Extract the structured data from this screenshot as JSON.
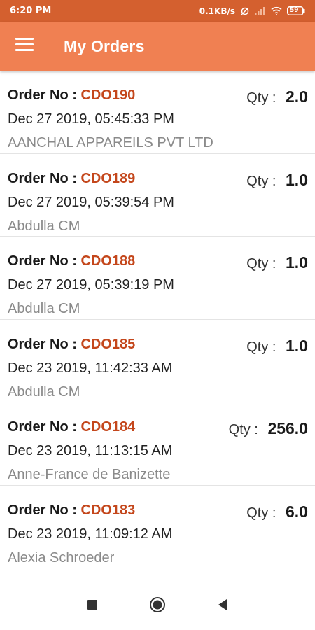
{
  "status_bar": {
    "time": "6:20 PM",
    "network_speed": "0.1KB/s",
    "battery": "59"
  },
  "app_bar": {
    "title": "My Orders",
    "menu_icon": "hamburger-menu-icon"
  },
  "orders": [
    {
      "order_label": "Order No : ",
      "order_no": "CDO190",
      "qty_label": "Qty : ",
      "qty": "2.0",
      "date": "Dec 27 2019, 05:45:33 PM",
      "customer": "AANCHAL APPAREILS PVT LTD"
    },
    {
      "order_label": "Order No : ",
      "order_no": "CDO189",
      "qty_label": "Qty : ",
      "qty": "1.0",
      "date": "Dec 27 2019, 05:39:54 PM",
      "customer": "Abdulla CM"
    },
    {
      "order_label": "Order No : ",
      "order_no": "CDO188",
      "qty_label": "Qty : ",
      "qty": "1.0",
      "date": "Dec 27 2019, 05:39:19 PM",
      "customer": "Abdulla CM"
    },
    {
      "order_label": "Order No : ",
      "order_no": "CDO185",
      "qty_label": "Qty : ",
      "qty": "1.0",
      "date": "Dec 23 2019, 11:42:33 AM",
      "customer": "Abdulla CM"
    },
    {
      "order_label": "Order No : ",
      "order_no": "CDO184",
      "qty_label": "Qty : ",
      "qty": "256.0",
      "date": "Dec 23 2019, 11:13:15 AM",
      "customer": "Anne-France de Banizette"
    },
    {
      "order_label": "Order No : ",
      "order_no": "CDO183",
      "qty_label": "Qty : ",
      "qty": "6.0",
      "date": "Dec 23 2019, 11:09:12 AM",
      "customer": "Alexia Schroeder"
    }
  ],
  "colors": {
    "status_bar": "#d4602f",
    "app_bar": "#f08052",
    "order_number": "#c4471c",
    "customer_text": "#8a8a8a"
  }
}
